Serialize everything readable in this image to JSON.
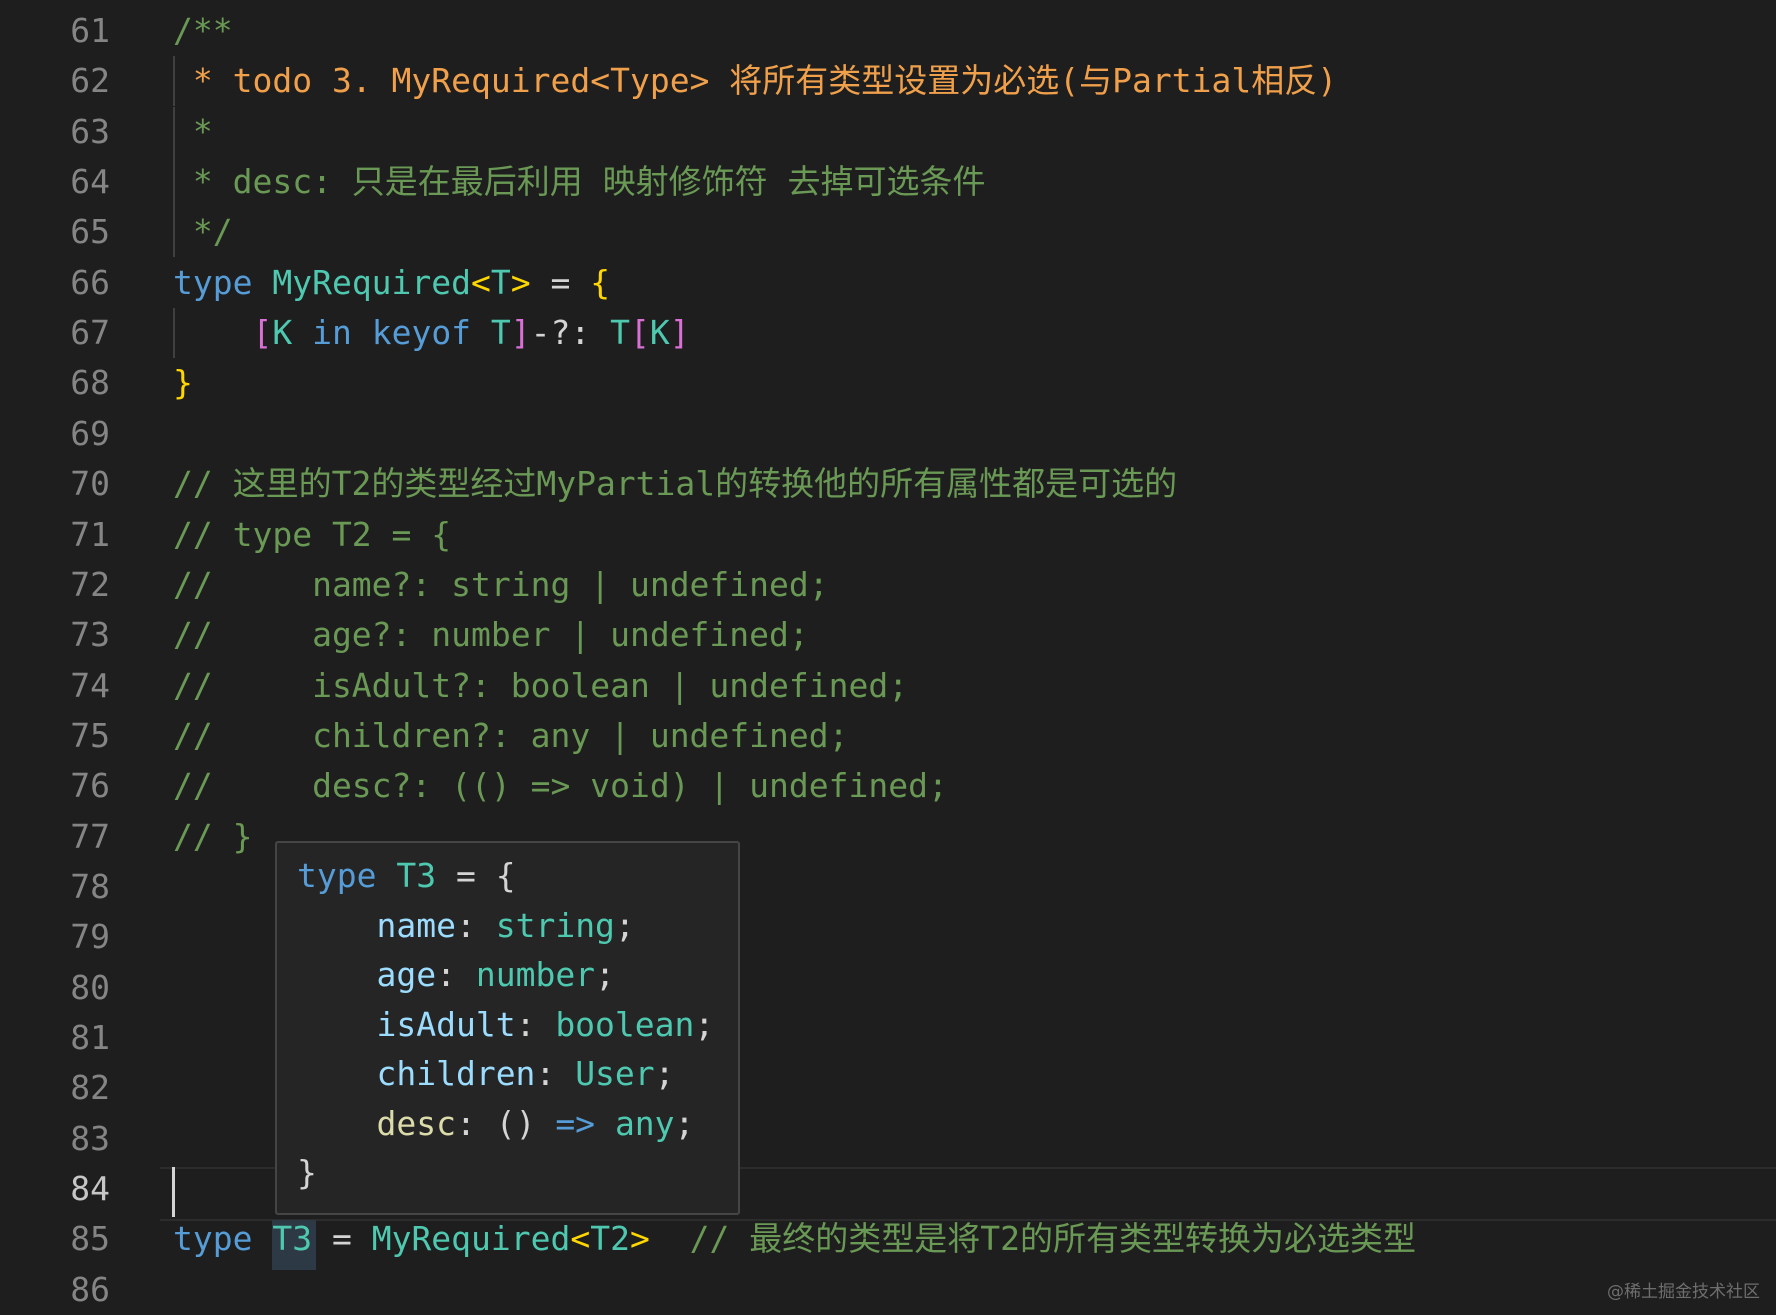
{
  "editor": {
    "lines": [
      {
        "num": "61",
        "parts": [
          {
            "t": "/**",
            "c": "tok-green"
          }
        ]
      },
      {
        "num": "62",
        "parts": [
          {
            "t": " * todo 3. MyRequired<Type> 将所有类型设置为必选(与Partial相反)",
            "c": "tok-orange"
          }
        ]
      },
      {
        "num": "63",
        "parts": [
          {
            "t": " *",
            "c": "tok-green"
          }
        ]
      },
      {
        "num": "64",
        "parts": [
          {
            "t": " * desc: 只是在最后利用 映射修饰符 去掉可选条件",
            "c": "tok-green"
          }
        ]
      },
      {
        "num": "65",
        "parts": [
          {
            "t": " */",
            "c": "tok-green"
          }
        ]
      },
      {
        "num": "66",
        "parts": [
          {
            "t": "type ",
            "c": "tok-blue"
          },
          {
            "t": "MyRequired",
            "c": "tok-type"
          },
          {
            "t": "<",
            "c": "tok-gold"
          },
          {
            "t": "T",
            "c": "tok-type"
          },
          {
            "t": ">",
            "c": "tok-gold"
          },
          {
            "t": " = ",
            "c": "tok-white"
          },
          {
            "t": "{",
            "c": "tok-gold"
          }
        ]
      },
      {
        "num": "67",
        "parts": [
          {
            "t": "    ",
            "c": "tok-white"
          },
          {
            "t": "[",
            "c": "tok-mag"
          },
          {
            "t": "K ",
            "c": "tok-type"
          },
          {
            "t": "in keyof ",
            "c": "tok-blue"
          },
          {
            "t": "T",
            "c": "tok-type"
          },
          {
            "t": "]",
            "c": "tok-mag"
          },
          {
            "t": "-?: ",
            "c": "tok-white"
          },
          {
            "t": "T",
            "c": "tok-type"
          },
          {
            "t": "[",
            "c": "tok-mag"
          },
          {
            "t": "K",
            "c": "tok-type"
          },
          {
            "t": "]",
            "c": "tok-mag"
          }
        ]
      },
      {
        "num": "68",
        "parts": [
          {
            "t": "}",
            "c": "tok-gold"
          }
        ]
      },
      {
        "num": "69",
        "parts": []
      },
      {
        "num": "70",
        "parts": [
          {
            "t": "// 这里的T2的类型经过MyPartial的转换他的所有属性都是可选的",
            "c": "tok-green"
          }
        ]
      },
      {
        "num": "71",
        "parts": [
          {
            "t": "// type T2 = {",
            "c": "tok-green"
          }
        ]
      },
      {
        "num": "72",
        "parts": [
          {
            "t": "//     name?: string | undefined;",
            "c": "tok-green"
          }
        ]
      },
      {
        "num": "73",
        "parts": [
          {
            "t": "//     age?: number | undefined;",
            "c": "tok-green"
          }
        ]
      },
      {
        "num": "74",
        "parts": [
          {
            "t": "//     isAdult?: boolean | undefined;",
            "c": "tok-green"
          }
        ]
      },
      {
        "num": "75",
        "parts": [
          {
            "t": "//     children?: any | undefined;",
            "c": "tok-green"
          }
        ]
      },
      {
        "num": "76",
        "parts": [
          {
            "t": "//     desc?: (() => void) | undefined;",
            "c": "tok-green"
          }
        ]
      },
      {
        "num": "77",
        "parts": [
          {
            "t": "// }",
            "c": "tok-green"
          }
        ]
      },
      {
        "num": "78",
        "parts": []
      },
      {
        "num": "79",
        "parts": []
      },
      {
        "num": "80",
        "parts": []
      },
      {
        "num": "81",
        "parts": []
      },
      {
        "num": "82",
        "parts": []
      },
      {
        "num": "83",
        "parts": []
      },
      {
        "num": "84",
        "parts": []
      },
      {
        "num": "85",
        "parts": [
          {
            "t": "type ",
            "c": "tok-blue"
          },
          {
            "t": "T3",
            "c": "tok-type"
          },
          {
            "t": " = ",
            "c": "tok-white"
          },
          {
            "t": "MyRequired",
            "c": "tok-type"
          },
          {
            "t": "<",
            "c": "tok-gold"
          },
          {
            "t": "T2",
            "c": "tok-type"
          },
          {
            "t": ">",
            "c": "tok-gold"
          },
          {
            "t": "  // 最终的类型是将T2的所有类型转换为必选类型",
            "c": "tok-green"
          }
        ]
      },
      {
        "num": "86",
        "parts": []
      }
    ],
    "active_line": "84"
  },
  "hover": {
    "lines": [
      [
        {
          "t": "type ",
          "c": "tok-blue"
        },
        {
          "t": "T3",
          "c": "tok-type"
        },
        {
          "t": " = {",
          "c": "tok-white"
        }
      ],
      [
        {
          "t": "    ",
          "c": "tok-white"
        },
        {
          "t": "name",
          "c": "tok-light"
        },
        {
          "t": ": ",
          "c": "tok-white"
        },
        {
          "t": "string",
          "c": "tok-type"
        },
        {
          "t": ";",
          "c": "tok-white"
        }
      ],
      [
        {
          "t": "    ",
          "c": "tok-white"
        },
        {
          "t": "age",
          "c": "tok-light"
        },
        {
          "t": ": ",
          "c": "tok-white"
        },
        {
          "t": "number",
          "c": "tok-type"
        },
        {
          "t": ";",
          "c": "tok-white"
        }
      ],
      [
        {
          "t": "    ",
          "c": "tok-white"
        },
        {
          "t": "isAdult",
          "c": "tok-light"
        },
        {
          "t": ": ",
          "c": "tok-white"
        },
        {
          "t": "boolean",
          "c": "tok-type"
        },
        {
          "t": ";",
          "c": "tok-white"
        }
      ],
      [
        {
          "t": "    ",
          "c": "tok-white"
        },
        {
          "t": "children",
          "c": "tok-light"
        },
        {
          "t": ": ",
          "c": "tok-white"
        },
        {
          "t": "User",
          "c": "tok-type"
        },
        {
          "t": ";",
          "c": "tok-white"
        }
      ],
      [
        {
          "t": "    ",
          "c": "tok-white"
        },
        {
          "t": "desc",
          "c": "tok-yellow"
        },
        {
          "t": ": () ",
          "c": "tok-white"
        },
        {
          "t": "=>",
          "c": "tok-blue"
        },
        {
          "t": " ",
          "c": "tok-white"
        },
        {
          "t": "any",
          "c": "tok-type"
        },
        {
          "t": ";",
          "c": "tok-white"
        }
      ],
      [
        {
          "t": "}",
          "c": "tok-white"
        }
      ]
    ]
  },
  "watermark": "@稀土掘金技术社区",
  "colors": {
    "background": "#1e1e1e",
    "comment": "#6a9955",
    "todo": "#f0a04b",
    "keyword": "#569cd6",
    "type": "#4ec9b0",
    "bracket_gold": "#ffd700",
    "bracket_magenta": "#da70d6"
  }
}
